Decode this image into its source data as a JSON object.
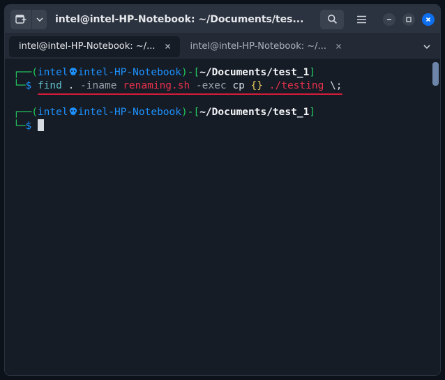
{
  "window": {
    "title": "intel@intel-HP-Notebook: ~/Documents/tes..."
  },
  "tabs": [
    {
      "label": "intel@intel-HP-Notebook: ~/...",
      "active": true
    },
    {
      "label": "intel@intel-HP-Notebook: ~/...",
      "active": false
    }
  ],
  "prompts": [
    {
      "user": "intel",
      "host": "intel-HP-Notebook",
      "path": "~/Documents/test_1",
      "command": {
        "text": "find . -iname renaming.sh -exec cp {} ./testing \\;",
        "tokens": [
          {
            "t": "find",
            "c": "teal"
          },
          {
            "t": " ",
            "c": "plain"
          },
          {
            "t": ".",
            "c": "plain"
          },
          {
            "t": " ",
            "c": "plain"
          },
          {
            "t": "-iname",
            "c": "grey"
          },
          {
            "t": " ",
            "c": "plain"
          },
          {
            "t": "renaming.sh",
            "c": "red"
          },
          {
            "t": " ",
            "c": "plain"
          },
          {
            "t": "-exec",
            "c": "grey"
          },
          {
            "t": " ",
            "c": "plain"
          },
          {
            "t": "cp",
            "c": "plain"
          },
          {
            "t": " ",
            "c": "plain"
          },
          {
            "t": "{}",
            "c": "yellow"
          },
          {
            "t": " ",
            "c": "plain"
          },
          {
            "t": "./testing",
            "c": "red"
          },
          {
            "t": " ",
            "c": "plain"
          },
          {
            "t": "\\;",
            "c": "plain"
          }
        ],
        "underlined": true
      }
    },
    {
      "user": "intel",
      "host": "intel-HP-Notebook",
      "path": "~/Documents/test_1",
      "command": null,
      "cursor": true
    }
  ],
  "colors": {
    "bg": "#161c26",
    "titlebar": "#2b3340",
    "accent": "#0d6ff0",
    "green": "#22c55e",
    "blue": "#1d92ff",
    "red": "#e7304a",
    "yellow": "#e2c35b",
    "teal": "#5fb9c6",
    "underline": "#d71c3a"
  },
  "icons": {
    "newtab": "new-terminal-tab-icon",
    "dropdown": "chevron-down-icon",
    "search": "search-icon",
    "menu": "hamburger-icon",
    "minimize": "minimize-icon",
    "maximize": "maximize-icon",
    "close": "window-close-icon",
    "skull": "kali-skull-icon"
  }
}
